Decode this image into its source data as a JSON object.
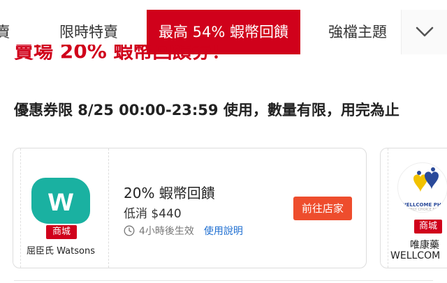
{
  "tabs": [
    {
      "label": "賣",
      "active": false
    },
    {
      "label": "限時特賣",
      "active": false
    },
    {
      "label": "最高 54% 蝦幣回饋",
      "active": true
    },
    {
      "label": "強檔主題",
      "active": false
    }
  ],
  "more_icon": "chevron-down-icon",
  "headline": "賣場 20% 蝦幣回饋券！",
  "notice": "優惠券限 8/25 00:00-23:59 使用，數量有限，用完為止",
  "vouchers": [
    {
      "shop_logo_text": "w",
      "shop_badge": "商城",
      "shop_name": "屈臣氏 Watsons",
      "title": "20% 蝦幣回饋",
      "min_spend": "低消 $440",
      "clock_icon": "clock-icon",
      "time_text": "4小時後生效",
      "terms_link": "使用說明",
      "button_label": "前往店家"
    },
    {
      "logo_text": "WELLCOME PHA",
      "logo_subtext": "ONLY CHOICE FOR",
      "shop_badge": "商城",
      "shop_name_line1": "唯康藥",
      "shop_name_line2": "WELLCOM"
    }
  ],
  "colors": {
    "brand": "#d0011b",
    "button": "#ee4d2d",
    "link": "#1f6fd1",
    "watsons": "#1ab1a1"
  }
}
